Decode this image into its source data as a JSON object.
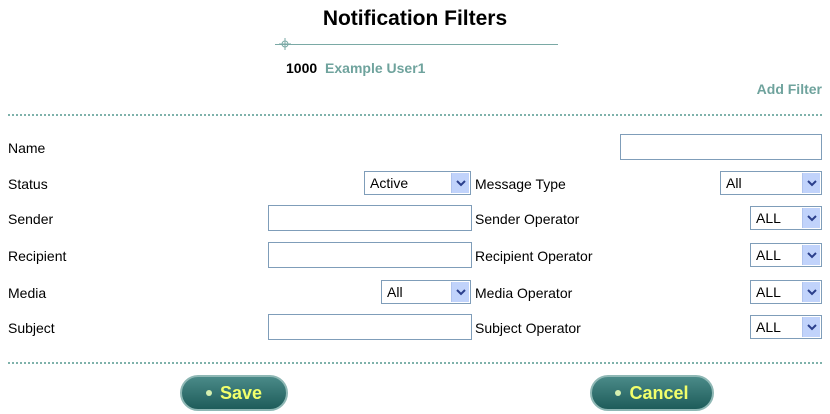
{
  "header": {
    "title": "Notification Filters",
    "user_id": "1000",
    "user_name": "Example User1",
    "add_filter": "Add Filter"
  },
  "form": {
    "name_label": "Name",
    "name_value": "",
    "status_label": "Status",
    "status_value": "Active",
    "message_type_label": "Message Type",
    "message_type_value": "All",
    "sender_label": "Sender",
    "sender_value": "",
    "sender_operator_label": "Sender Operator",
    "sender_operator_value": "ALL",
    "recipient_label": "Recipient",
    "recipient_value": "",
    "recipient_operator_label": "Recipient Operator",
    "recipient_operator_value": "ALL",
    "media_label": "Media",
    "media_value": "All",
    "media_operator_label": "Media Operator",
    "media_operator_value": "ALL",
    "subject_label": "Subject",
    "subject_value": "",
    "subject_operator_label": "Subject Operator",
    "subject_operator_value": "ALL"
  },
  "buttons": {
    "save": "Save",
    "cancel": "Cancel"
  },
  "colors": {
    "accent": "#6fa39d",
    "button_bg": "#2e6e6c",
    "button_text": "#f2ff6b"
  }
}
